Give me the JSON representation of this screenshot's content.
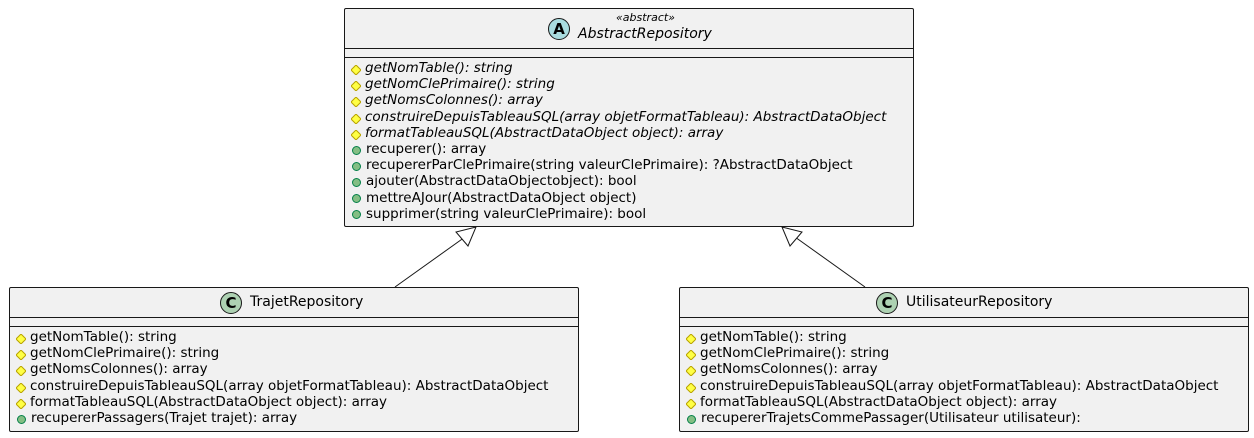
{
  "abstract_class": {
    "stereotype": "«abstract»",
    "name": "AbstractRepository",
    "badge": "A",
    "badge_color": "#a9dcdf",
    "methods": [
      {
        "vis": "protected",
        "abstract": true,
        "text": "getNomTable(): string"
      },
      {
        "vis": "protected",
        "abstract": true,
        "text": "getNomClePrimaire(): string"
      },
      {
        "vis": "protected",
        "abstract": true,
        "text": "getNomsColonnes(): array"
      },
      {
        "vis": "protected",
        "abstract": true,
        "text": "construireDepuisTableauSQL(array objetFormatTableau): AbstractDataObject"
      },
      {
        "vis": "protected",
        "abstract": true,
        "text": "formatTableauSQL(AbstractDataObject object): array"
      },
      {
        "vis": "public",
        "abstract": false,
        "text": "recuperer(): array"
      },
      {
        "vis": "public",
        "abstract": false,
        "text": "recupererParClePrimaire(string valeurClePrimaire): ?AbstractDataObject"
      },
      {
        "vis": "public",
        "abstract": false,
        "text": "ajouter(AbstractDataObjectobject): bool"
      },
      {
        "vis": "public",
        "abstract": false,
        "text": "mettreAJour(AbstractDataObject object)"
      },
      {
        "vis": "public",
        "abstract": false,
        "text": "supprimer(string valeurClePrimaire): bool"
      }
    ]
  },
  "trajet_class": {
    "name": "TrajetRepository",
    "badge": "C",
    "badge_color": "#add1b2",
    "methods": [
      {
        "vis": "protected",
        "text": "getNomTable(): string"
      },
      {
        "vis": "protected",
        "text": "getNomClePrimaire(): string"
      },
      {
        "vis": "protected",
        "text": "getNomsColonnes(): array"
      },
      {
        "vis": "protected",
        "text": "construireDepuisTableauSQL(array objetFormatTableau): AbstractDataObject"
      },
      {
        "vis": "protected",
        "text": "formatTableauSQL(AbstractDataObject object): array"
      },
      {
        "vis": "public",
        "text": "recupererPassagers(Trajet trajet): array"
      }
    ]
  },
  "utilisateur_class": {
    "name": "UtilisateurRepository",
    "badge": "C",
    "badge_color": "#add1b2",
    "methods": [
      {
        "vis": "protected",
        "text": "getNomTable(): string"
      },
      {
        "vis": "protected",
        "text": "getNomClePrimaire(): string"
      },
      {
        "vis": "protected",
        "text": "getNomsColonnes(): array"
      },
      {
        "vis": "protected",
        "text": "construireDepuisTableauSQL(array objetFormatTableau): AbstractDataObject"
      },
      {
        "vis": "protected",
        "text": "formatTableauSQL(AbstractDataObject object): array"
      },
      {
        "vis": "public",
        "text": "recupererTrajetsCommePassager(Utilisateur utilisateur):"
      }
    ]
  },
  "colors": {
    "box_fill": "#f1f1f1",
    "border": "#181818",
    "protected_marker": "#ffff44",
    "protected_marker_border": "#b8a200",
    "public_marker": "#84be84",
    "public_marker_border": "#038048"
  }
}
